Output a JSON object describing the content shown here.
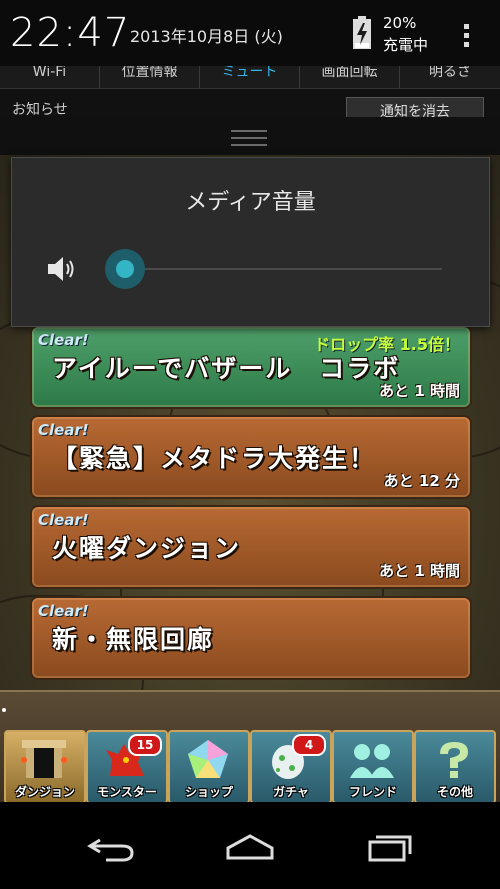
{
  "status_bar": {
    "time": "22:47",
    "date": "2013年10月8日 (火)",
    "battery_percent": "20%",
    "battery_status": "充電中",
    "battery_level": 0.2
  },
  "quick_settings": {
    "toggles": [
      {
        "label": "Wi-Fi",
        "active": false
      },
      {
        "label": "位置情報",
        "active": false
      },
      {
        "label": "ミュート",
        "active": true
      },
      {
        "label": "画面回転",
        "active": false
      },
      {
        "label": "明るさ",
        "active": false
      }
    ]
  },
  "notifications": {
    "label": "お知らせ",
    "clear_button": "通知を消去"
  },
  "volume_dialog": {
    "title": "メディア音量",
    "level": 0.0,
    "icon": "speaker-icon",
    "accent_color": "#33b5c5"
  },
  "events": [
    {
      "clear": "Clear!",
      "title": "アイルーでバザール　コラボ",
      "promo": "ドロップ率 1.5倍！",
      "remaining": "あと 1 時間",
      "color": "green"
    },
    {
      "clear": "Clear!",
      "title": "【緊急】メタドラ大発生！",
      "promo": "",
      "remaining": "あと 12 分",
      "color": "brown"
    },
    {
      "clear": "Clear!",
      "title": "火曜ダンジョン",
      "promo": "",
      "remaining": "あと 1 時間",
      "color": "brown"
    },
    {
      "clear": "Clear!",
      "title": "新・無限回廊",
      "promo": "",
      "remaining": "",
      "color": "brown"
    }
  ],
  "game_menu": {
    "items": [
      {
        "label": "ダンジョン",
        "icon": "dungeon-gate-icon",
        "badge": ""
      },
      {
        "label": "モンスター",
        "icon": "dragon-icon",
        "badge": "15"
      },
      {
        "label": "ショップ",
        "icon": "rainbow-gem-icon",
        "badge": ""
      },
      {
        "label": "ガチャ",
        "icon": "egg-icon",
        "badge": "4"
      },
      {
        "label": "フレンド",
        "icon": "friends-icon",
        "badge": ""
      },
      {
        "label": "その他",
        "icon": "question-icon",
        "badge": ""
      }
    ]
  },
  "nav_bar": {
    "icons": [
      "back-icon",
      "home-icon",
      "recent-apps-icon"
    ]
  }
}
